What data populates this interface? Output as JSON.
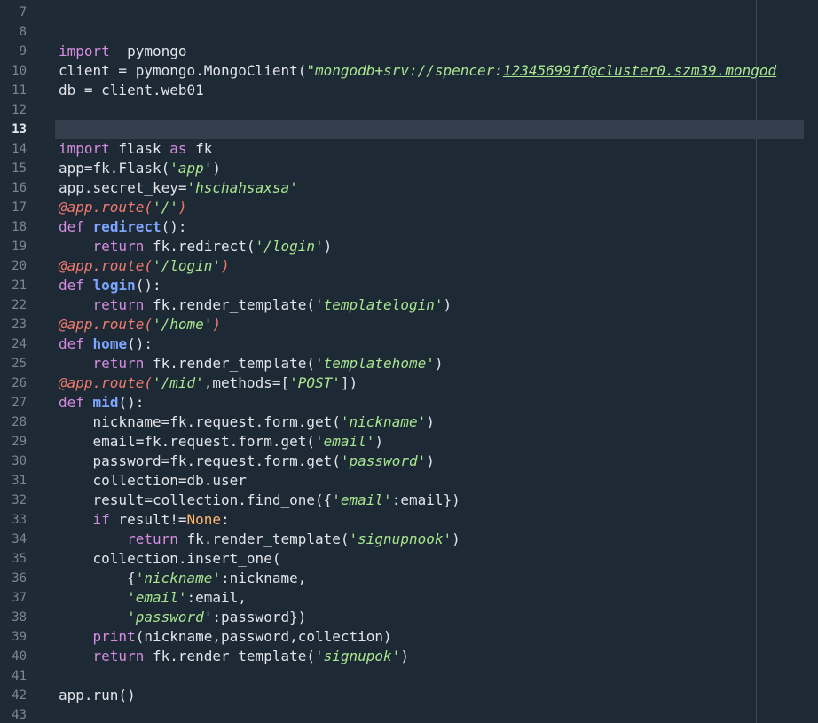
{
  "editor": {
    "current_line": 13,
    "lines": [
      {
        "n": "7",
        "segs": []
      },
      {
        "n": "8",
        "segs": []
      },
      {
        "n": "9",
        "segs": [
          [
            "kw",
            "import"
          ],
          [
            "",
            "  pymongo"
          ]
        ]
      },
      {
        "n": "10",
        "segs": [
          [
            "",
            "client = pymongo.MongoClient("
          ],
          [
            "str",
            "\"mongodb+srv://spencer:"
          ],
          [
            "str url",
            "12345699ff@cluster0.szm39.mongod"
          ]
        ]
      },
      {
        "n": "11",
        "segs": [
          [
            "",
            "db = client.web01"
          ]
        ]
      },
      {
        "n": "12",
        "segs": []
      },
      {
        "n": "13",
        "segs": []
      },
      {
        "n": "14",
        "segs": [
          [
            "kw",
            "import"
          ],
          [
            "",
            " flask "
          ],
          [
            "kw",
            "as"
          ],
          [
            "",
            " fk"
          ]
        ]
      },
      {
        "n": "15",
        "segs": [
          [
            "",
            "app=fk.Flask("
          ],
          [
            "str",
            "'app'"
          ],
          [
            "",
            ")"
          ]
        ]
      },
      {
        "n": "16",
        "segs": [
          [
            "",
            "app.secret_key="
          ],
          [
            "str",
            "'hschahsaxsa'"
          ]
        ]
      },
      {
        "n": "17",
        "segs": [
          [
            "dec",
            "@app.route("
          ],
          [
            "str",
            "'/'"
          ],
          [
            "dec",
            ")"
          ]
        ]
      },
      {
        "n": "18",
        "segs": [
          [
            "kw",
            "def"
          ],
          [
            "",
            " "
          ],
          [
            "fn",
            "redirect"
          ],
          [
            "",
            "():"
          ]
        ]
      },
      {
        "n": "19",
        "segs": [
          [
            "",
            "    "
          ],
          [
            "kw",
            "return"
          ],
          [
            "",
            " fk.redirect("
          ],
          [
            "str",
            "'/login'"
          ],
          [
            "",
            ")"
          ]
        ]
      },
      {
        "n": "20",
        "segs": [
          [
            "dec",
            "@app.route("
          ],
          [
            "str",
            "'/login'"
          ],
          [
            "dec",
            ")"
          ]
        ]
      },
      {
        "n": "21",
        "segs": [
          [
            "kw",
            "def"
          ],
          [
            "",
            " "
          ],
          [
            "fn",
            "login"
          ],
          [
            "",
            "():"
          ]
        ]
      },
      {
        "n": "22",
        "segs": [
          [
            "",
            "    "
          ],
          [
            "kw",
            "return"
          ],
          [
            "",
            " fk.render_template("
          ],
          [
            "str",
            "'templatelogin'"
          ],
          [
            "",
            ")"
          ]
        ]
      },
      {
        "n": "23",
        "segs": [
          [
            "dec",
            "@app.route("
          ],
          [
            "str",
            "'/home'"
          ],
          [
            "dec",
            ")"
          ]
        ]
      },
      {
        "n": "24",
        "segs": [
          [
            "kw",
            "def"
          ],
          [
            "",
            " "
          ],
          [
            "fn",
            "home"
          ],
          [
            "",
            "():"
          ]
        ]
      },
      {
        "n": "25",
        "segs": [
          [
            "",
            "    "
          ],
          [
            "kw",
            "return"
          ],
          [
            "",
            " fk.render_template("
          ],
          [
            "str",
            "'templatehome'"
          ],
          [
            "",
            ")"
          ]
        ]
      },
      {
        "n": "26",
        "segs": [
          [
            "dec",
            "@app.route("
          ],
          [
            "str",
            "'/mid'"
          ],
          [
            "",
            ",methods=["
          ],
          [
            "str",
            "'POST'"
          ],
          [
            "",
            "])"
          ]
        ]
      },
      {
        "n": "27",
        "segs": [
          [
            "kw",
            "def"
          ],
          [
            "",
            " "
          ],
          [
            "fn",
            "mid"
          ],
          [
            "",
            "():"
          ]
        ]
      },
      {
        "n": "28",
        "segs": [
          [
            "",
            "    nickname=fk.request.form.get("
          ],
          [
            "str",
            "'nickname'"
          ],
          [
            "",
            ")"
          ]
        ]
      },
      {
        "n": "29",
        "segs": [
          [
            "",
            "    email=fk.request.form.get("
          ],
          [
            "str",
            "'email'"
          ],
          [
            "",
            ")"
          ]
        ]
      },
      {
        "n": "30",
        "segs": [
          [
            "",
            "    password=fk.request.form.get("
          ],
          [
            "str",
            "'password'"
          ],
          [
            "",
            ")"
          ]
        ]
      },
      {
        "n": "31",
        "segs": [
          [
            "",
            "    collection=db.user"
          ]
        ]
      },
      {
        "n": "32",
        "segs": [
          [
            "",
            "    result=collection.find_one({"
          ],
          [
            "str",
            "'email'"
          ],
          [
            "",
            ":email})"
          ]
        ]
      },
      {
        "n": "33",
        "segs": [
          [
            "",
            "    "
          ],
          [
            "kw",
            "if"
          ],
          [
            "",
            " result!="
          ],
          [
            "kw2",
            "None"
          ],
          [
            "",
            ":"
          ]
        ]
      },
      {
        "n": "34",
        "segs": [
          [
            "",
            "        "
          ],
          [
            "kw",
            "return"
          ],
          [
            "",
            " fk.render_template("
          ],
          [
            "str",
            "'signupnook'"
          ],
          [
            "",
            ")"
          ]
        ]
      },
      {
        "n": "35",
        "segs": [
          [
            "",
            "    collection.insert_one("
          ]
        ]
      },
      {
        "n": "36",
        "segs": [
          [
            "",
            "        {"
          ],
          [
            "str",
            "'nickname'"
          ],
          [
            "",
            ":nickname,"
          ]
        ]
      },
      {
        "n": "37",
        "segs": [
          [
            "",
            "        "
          ],
          [
            "str",
            "'email'"
          ],
          [
            "",
            ":email,"
          ]
        ]
      },
      {
        "n": "38",
        "segs": [
          [
            "",
            "        "
          ],
          [
            "str",
            "'password'"
          ],
          [
            "",
            ":password})"
          ]
        ]
      },
      {
        "n": "39",
        "segs": [
          [
            "",
            "    "
          ],
          [
            "bi",
            "print"
          ],
          [
            "",
            "(nickname,password,collection)"
          ]
        ]
      },
      {
        "n": "40",
        "segs": [
          [
            "",
            "    "
          ],
          [
            "kw",
            "return"
          ],
          [
            "",
            " fk.render_template("
          ],
          [
            "str",
            "'signupok'"
          ],
          [
            "",
            ")"
          ]
        ]
      },
      {
        "n": "41",
        "segs": []
      },
      {
        "n": "42",
        "segs": [
          [
            "",
            "app.run()"
          ]
        ]
      },
      {
        "n": "43",
        "segs": []
      }
    ]
  }
}
